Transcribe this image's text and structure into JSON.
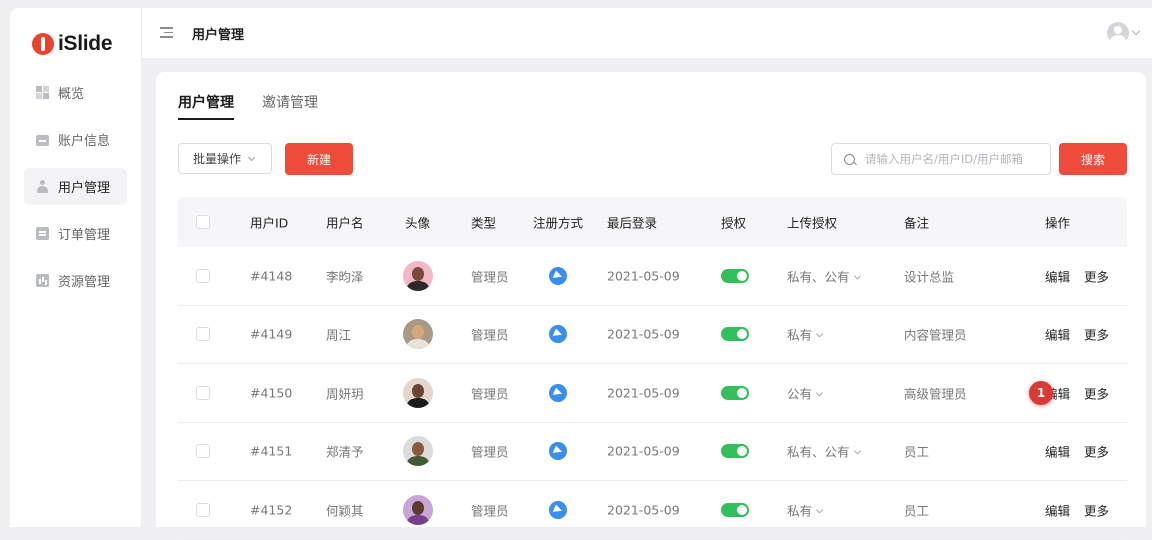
{
  "app": {
    "logo_text": "iSlide",
    "brand_color": "#ee4b3a"
  },
  "sidebar": {
    "items": [
      {
        "label": "概览",
        "icon": "grid-icon",
        "active": false
      },
      {
        "label": "账户信息",
        "icon": "card-icon",
        "active": false
      },
      {
        "label": "用户管理",
        "icon": "user-icon",
        "active": true
      },
      {
        "label": "订单管理",
        "icon": "clipboard-icon",
        "active": false
      },
      {
        "label": "资源管理",
        "icon": "chart-icon",
        "active": false
      }
    ]
  },
  "header": {
    "title": "用户管理"
  },
  "tabs": [
    {
      "label": "用户管理",
      "active": true
    },
    {
      "label": "邀请管理",
      "active": false
    }
  ],
  "toolbar": {
    "batch_label": "批量操作",
    "new_label": "新建",
    "search_placeholder": "请输入用户名/用户ID/用户邮箱",
    "search_value": "",
    "search_label": "搜索"
  },
  "table": {
    "columns": [
      "用户ID",
      "用户名",
      "头像",
      "类型",
      "注册方式",
      "最后登录",
      "授权",
      "上传授权",
      "备注",
      "操作"
    ],
    "edit_label": "编辑",
    "more_label": "更多",
    "rows": [
      {
        "id": "#4148",
        "name": "李昀泽",
        "type": "管理员",
        "last_login": "2021-05-09",
        "authorized": true,
        "upload_perm": "私有、公有",
        "note": "设计总监"
      },
      {
        "id": "#4149",
        "name": "周江",
        "type": "管理员",
        "last_login": "2021-05-09",
        "authorized": true,
        "upload_perm": "私有",
        "note": "内容管理员"
      },
      {
        "id": "#4150",
        "name": "周妍玥",
        "type": "管理员",
        "last_login": "2021-05-09",
        "authorized": true,
        "upload_perm": "公有",
        "note": "高级管理员"
      },
      {
        "id": "#4151",
        "name": "郑清予",
        "type": "管理员",
        "last_login": "2021-05-09",
        "authorized": true,
        "upload_perm": "私有、公有",
        "note": "员工"
      },
      {
        "id": "#4152",
        "name": "何颖其",
        "type": "管理员",
        "last_login": "2021-05-09",
        "authorized": true,
        "upload_perm": "私有",
        "note": "员工"
      }
    ]
  },
  "annotation": {
    "badge_text": "1",
    "color": "#d93a36"
  }
}
